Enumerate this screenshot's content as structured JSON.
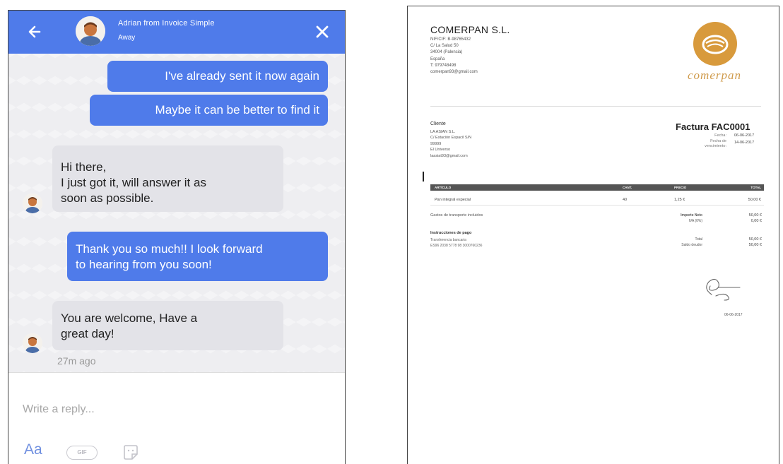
{
  "chat": {
    "header": {
      "agent_name": "Adrian from Invoice Simple",
      "agent_status": "Away",
      "accent_color": "#4f7bea"
    },
    "messages": [
      {
        "from": "user",
        "text": "I've already sent it now again"
      },
      {
        "from": "user",
        "text": "Maybe it can be better to find it"
      },
      {
        "from": "agent",
        "lines": [
          "Hi there,",
          "I just got it, will answer it as",
          "soon as possible."
        ]
      },
      {
        "from": "user",
        "lines": [
          "Thank you so much!! I look forward",
          "to hearing from you soon!"
        ]
      },
      {
        "from": "agent",
        "lines": [
          "You are welcome, Have a",
          "great day!"
        ]
      }
    ],
    "timestamp": "27m ago",
    "composer": {
      "placeholder": "Write a reply...",
      "text_tool": "Aa",
      "gif_tool": "GIF",
      "icons": [
        "back-arrow-icon",
        "close-icon",
        "sticker-icon"
      ]
    }
  },
  "invoice": {
    "company": {
      "name": "COMERPAN S.L.",
      "lines": [
        "NIF/CIF: B-98765432",
        "C/ La Salud 50",
        "34004 (Palencia)",
        "España",
        "T: 979748498",
        "comerpan93@gmail.com"
      ],
      "logo_text": "comerpan",
      "logo_color": "#d89a3c"
    },
    "client": {
      "title": "Cliente",
      "lines": [
        "LA ASIAN S.L.",
        "C/ Estación Espacil S/N",
        "99999",
        "El Universo",
        "laasiat93@gmail.com"
      ]
    },
    "meta": {
      "title": "Factura FAC0001",
      "date_label": "Fecha:",
      "date_value": "06-06-2017",
      "due_label_1": "Fecha de",
      "due_label_2": "vencimiento:",
      "due_value": "14-06-2017"
    },
    "table": {
      "headers": [
        "ARTÍCULO",
        "CANT.",
        "PRECIO",
        "TOTAL"
      ],
      "rows": [
        [
          "Pan integral especial",
          "40",
          "1,25 €",
          "50,00 €"
        ]
      ]
    },
    "shipping_note": "Gastos de transporte incluidos",
    "totals": {
      "net_label": "Importe Neto",
      "net_value": "50,00 €",
      "vat_label": "IVA (0%)",
      "vat_value": "0,00 €",
      "total_label": "Total",
      "total_value": "50,00 €",
      "due_label": "Saldo deudor",
      "due_value": "50,00 €"
    },
    "payment": {
      "title": "Instrucciones de pago",
      "lines": [
        "Transferencia bancaria",
        "ES96 2038 5778 98 3000760236"
      ]
    },
    "signature_date": "06-06-2017"
  }
}
